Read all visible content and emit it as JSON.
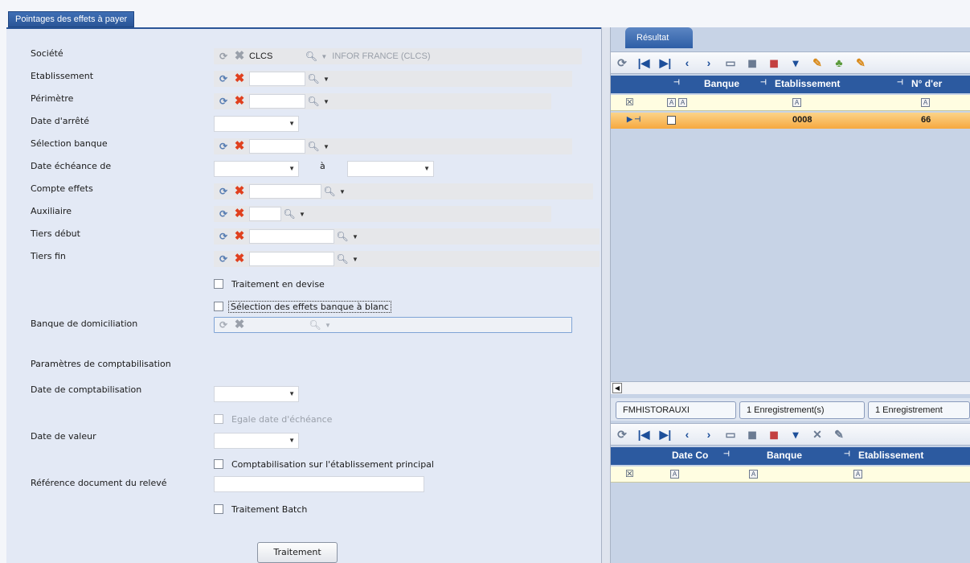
{
  "window": {
    "tab_title": "Pointages des effets à payer"
  },
  "form": {
    "societe": {
      "label": "Société",
      "code": "CLCS",
      "name": "INFOR FRANCE (CLCS)"
    },
    "etablissement": {
      "label": "Etablissement"
    },
    "perimetre": {
      "label": "Périmètre"
    },
    "date_arrete": {
      "label": "Date d'arrêté"
    },
    "selection_banque": {
      "label": "Sélection banque"
    },
    "date_echeance": {
      "label": "Date échéance de",
      "to_label": "à"
    },
    "compte_effets": {
      "label": "Compte effets"
    },
    "auxiliaire": {
      "label": "Auxiliaire"
    },
    "tiers_debut": {
      "label": "Tiers début"
    },
    "tiers_fin": {
      "label": "Tiers fin"
    },
    "traitement_devise": {
      "label": "Traitement en devise",
      "checked": false
    },
    "selection_effets_blanc": {
      "label": "Sélection des effets banque à blanc",
      "checked": false
    },
    "banque_domiciliation": {
      "label": "Banque de domiciliation"
    },
    "section_compta": "Paramètres de comptabilisation",
    "date_comptabilisation": {
      "label": "Date de comptabilisation"
    },
    "egale_date_echeance": {
      "label": "Egale date d'échéance",
      "checked": false
    },
    "date_valeur": {
      "label": "Date de valeur"
    },
    "compta_etab_principal": {
      "label": "Comptabilisation sur l'établissement principal",
      "checked": false
    },
    "reference_doc": {
      "label": "Référence document du relevé",
      "value": ""
    },
    "traitement_batch": {
      "label": "Traitement Batch",
      "checked": false
    },
    "submit_label": "Traitement"
  },
  "result": {
    "tab_label": "Résultat",
    "columns": [
      "Banque",
      "Etablissement",
      "N° d'er"
    ],
    "row": {
      "etablissement": "0008",
      "numero": "66"
    }
  },
  "history": {
    "table_name": "FMHISTORAUXI",
    "count1": "1 Enregistrement(s)",
    "count2": "1 Enregistrement",
    "columns": [
      "Date Co",
      "Banque",
      "Etablissement"
    ]
  },
  "colors": {
    "accent": "#2c5aa0",
    "selected_row": "#f6a93f",
    "filter_row": "#fffde1",
    "panel_bg": "#e3e9f5"
  }
}
